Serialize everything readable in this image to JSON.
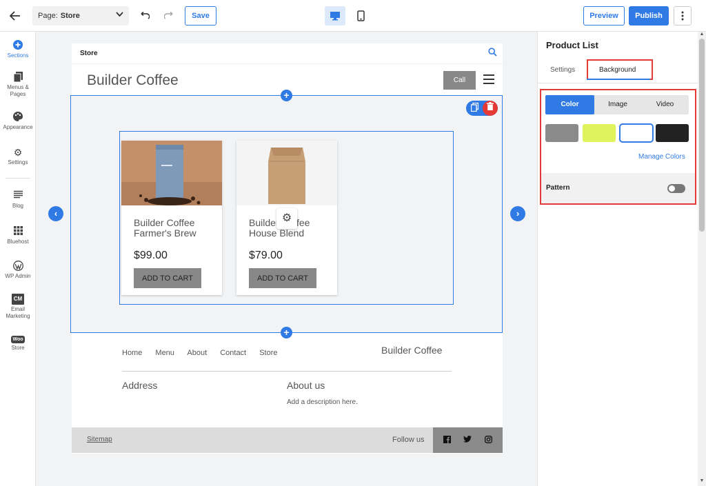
{
  "toolbar": {
    "page_prefix": "Page:",
    "page_value": "Store",
    "save_label": "Save",
    "preview_label": "Preview",
    "publish_label": "Publish"
  },
  "sidebar": {
    "items": [
      {
        "label": "Sections",
        "icon": "plus-circle-icon"
      },
      {
        "label": "Menus &",
        "label2": "Pages",
        "icon": "pages-icon"
      },
      {
        "label": "Appearance",
        "icon": "palette-icon"
      },
      {
        "label": "Settings",
        "icon": "gear-icon"
      },
      {
        "label": "Blog",
        "icon": "blog-icon"
      },
      {
        "label": "Bluehost",
        "icon": "grid-icon"
      },
      {
        "label": "WP Admin",
        "icon": "wordpress-icon"
      },
      {
        "label": "Email",
        "label2": "Marketing",
        "icon": "cm-icon",
        "badge": "CM"
      },
      {
        "label": "Store",
        "icon": "woo-icon",
        "badge": "Woo"
      }
    ]
  },
  "site": {
    "header_store": "Store",
    "brand": "Builder Coffee",
    "call_label": "Call",
    "products": [
      {
        "name": "Builder Coffee Farmer's Brew",
        "price": "$99.00",
        "cta": "ADD TO CART"
      },
      {
        "name": "Builder Coffee House Blend",
        "price": "$79.00",
        "cta": "ADD TO CART"
      }
    ],
    "footer": {
      "nav": [
        "Home",
        "Menu",
        "About",
        "Contact",
        "Store"
      ],
      "brand": "Builder Coffee",
      "address": "Address",
      "about_title": "About us",
      "about_desc": "Add a description here.",
      "sitemap": "Sitemap",
      "follow": "Follow us",
      "social": [
        "f",
        "t",
        "ig"
      ]
    }
  },
  "panel": {
    "title": "Product List",
    "tabs": [
      "Settings",
      "Background"
    ],
    "active_tab": "Background",
    "bg_types": [
      "Color",
      "Image",
      "Video"
    ],
    "active_bg_type": "Color",
    "swatches": [
      "#8a8a8a",
      "#dff35c",
      "#ffffff",
      "#222222"
    ],
    "selected_swatch": 2,
    "manage_colors": "Manage Colors",
    "pattern_label": "Pattern",
    "pattern_enabled": false
  },
  "colors": {
    "accent": "#2f7ae5",
    "danger": "#e53935"
  }
}
